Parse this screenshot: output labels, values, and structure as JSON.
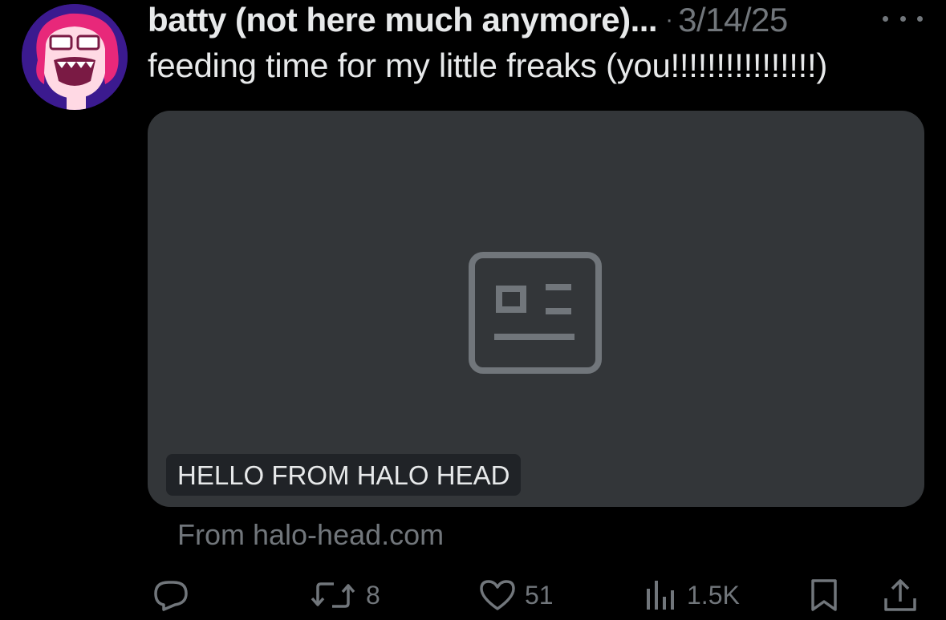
{
  "post": {
    "author_name": "batty (not here much anymore)...",
    "separator": "·",
    "date": "3/14/25",
    "text": "feeding time for my little freaks (you!!!!!!!!!!!!!!!!)"
  },
  "card": {
    "title": "HELLO FROM HALO HEAD",
    "source": "From halo-head.com",
    "icon": "article-placeholder-icon"
  },
  "actions": {
    "reply_count": "",
    "repost_count": "8",
    "like_count": "51",
    "views_count": "1.5K"
  },
  "icons": {
    "more": "more-horizontal-icon",
    "reply": "reply-icon",
    "repost": "repost-icon",
    "like": "heart-icon",
    "views": "views-icon",
    "bookmark": "bookmark-icon",
    "share": "share-icon"
  },
  "colors": {
    "background": "#000000",
    "primary_text": "#e7e9ea",
    "secondary_text": "#71767b",
    "card_background": "#333639",
    "avatar_pink": "#e8287a",
    "avatar_purple": "#3b1a8f"
  }
}
